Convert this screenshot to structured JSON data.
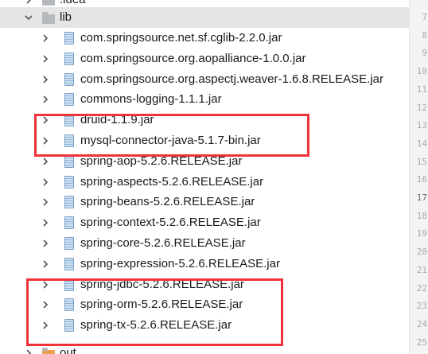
{
  "tree": {
    "top_partial": ".idea",
    "folder": "lib",
    "jars": [
      "com.springsource.net.sf.cglib-2.2.0.jar",
      "com.springsource.org.aopalliance-1.0.0.jar",
      "com.springsource.org.aspectj.weaver-1.6.8.RELEASE.jar",
      "commons-logging-1.1.1.jar",
      "druid-1.1.9.jar",
      "mysql-connector-java-5.1.7-bin.jar",
      "spring-aop-5.2.6.RELEASE.jar",
      "spring-aspects-5.2.6.RELEASE.jar",
      "spring-beans-5.2.6.RELEASE.jar",
      "spring-context-5.2.6.RELEASE.jar",
      "spring-core-5.2.6.RELEASE.jar",
      "spring-expression-5.2.6.RELEASE.jar",
      "spring-jdbc-5.2.6.RELEASE.jar",
      "spring-orm-5.2.6.RELEASE.jar",
      "spring-tx-5.2.6.RELEASE.jar"
    ],
    "bottom_partial": "out"
  },
  "gutter_numbers": [
    "7",
    "8",
    "9",
    "10",
    "11",
    "12",
    "13",
    "14",
    "15",
    "16",
    "17",
    "18",
    "19",
    "20",
    "21",
    "22",
    "23",
    "24",
    "25"
  ],
  "colors": {
    "highlight_box": "#f0323a",
    "selected_row": "#e5e5e5",
    "jar_icon": "#8fb3d6",
    "folder_icon": "#b5b9bd"
  },
  "icons": {
    "expand": "chevron-right-icon",
    "expanded": "chevron-down-icon",
    "folder": "folder-icon",
    "jar": "jar-icon"
  }
}
